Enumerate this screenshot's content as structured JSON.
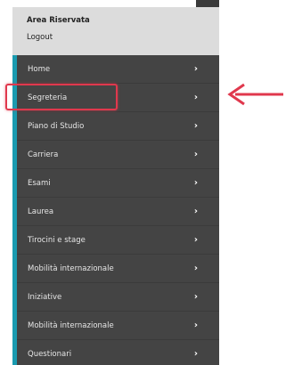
{
  "header": {
    "title": "Area Riservata",
    "logout_label": "Logout"
  },
  "menu": {
    "items": [
      {
        "label": "Home"
      },
      {
        "label": "Segreteria"
      },
      {
        "label": "Piano di Studio"
      },
      {
        "label": "Carriera"
      },
      {
        "label": "Esami"
      },
      {
        "label": "Laurea"
      },
      {
        "label": "Tirocini e stage"
      },
      {
        "label": "Mobilità internazionale"
      },
      {
        "label": "Iniziative"
      },
      {
        "label": "Mobilità internazionale"
      },
      {
        "label": "Questionari"
      }
    ]
  },
  "colors": {
    "highlight": "#e0384d",
    "accent": "#1a9bb0",
    "panel": "#444444",
    "header": "#dcdcdc"
  },
  "annotation": {
    "highlighted_item": "Segreteria",
    "icon": "arrow-left-icon"
  }
}
